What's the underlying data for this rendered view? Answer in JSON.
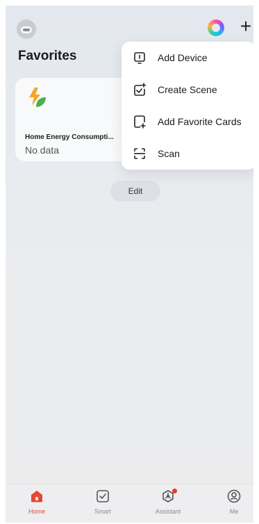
{
  "header": {
    "avatar_icon": "robot-avatar-icon",
    "assistant_icon": "ai-orb-icon",
    "add_label": "+"
  },
  "page": {
    "title": "Favorites"
  },
  "favorite_card": {
    "icon": "energy-leaf-bolt-icon",
    "title": "Home Energy Consumpti...",
    "value": "No data"
  },
  "edit_label": "Edit",
  "menu": {
    "items": [
      {
        "label": "Add Device",
        "icon": "device-icon"
      },
      {
        "label": "Create Scene",
        "icon": "create-scene-icon"
      },
      {
        "label": "Add Favorite Cards",
        "icon": "add-card-icon"
      },
      {
        "label": "Scan",
        "icon": "scan-icon"
      }
    ]
  },
  "tabs": [
    {
      "label": "Home",
      "icon": "home-icon",
      "active": true
    },
    {
      "label": "Smart",
      "icon": "checkbox-icon",
      "active": false
    },
    {
      "label": "Assistant",
      "icon": "assistant-icon",
      "active": false,
      "badge": true
    },
    {
      "label": "Me",
      "icon": "profile-icon",
      "active": false
    }
  ],
  "colors": {
    "accent": "#e2492f",
    "badge": "#ea3a2c",
    "energy_bolt": "#f5a623",
    "energy_leaf": "#4caf50"
  }
}
